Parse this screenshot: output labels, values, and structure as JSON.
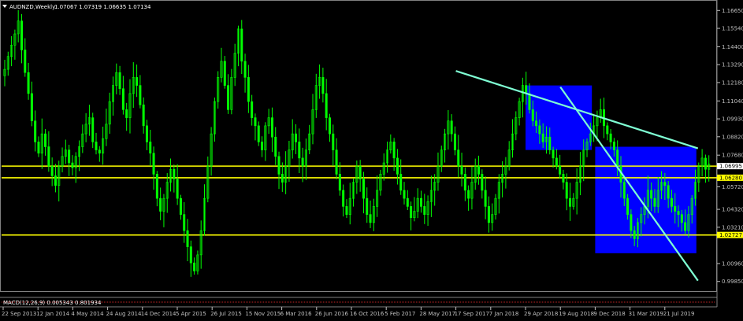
{
  "header": {
    "symbol": "AUDNZD,Weekly",
    "ohlc": "1.07067 1.07319 1.06635 1.07134"
  },
  "indicator": {
    "label": "MACD(12,26,9) 0.005343 0.801934"
  },
  "price_axis": [
    "1.16650",
    "1.15540",
    "1.14400",
    "1.13290",
    "1.12180",
    "1.11040",
    "1.09930",
    "1.08820",
    "1.07680",
    "1.05720",
    "1.04320",
    "1.03210",
    "1.00960",
    "0.99850"
  ],
  "levels": [
    {
      "label": "1.06995",
      "color": "#ffff00",
      "bg": "#ffffff",
      "price": 1.07
    },
    {
      "label": "1.06280",
      "color": "#ffff00",
      "bg": "#ffff00",
      "price": 1.0628
    },
    {
      "label": "1.02727",
      "color": "#ffff00",
      "bg": "#ffff00",
      "price": 1.0273
    }
  ],
  "dates": [
    "22 Sep 2013",
    "12 Jan 2014",
    "4 May 2014",
    "24 Aug 2014",
    "14 Dec 2014",
    "5 Apr 2015",
    "26 Jul 2015",
    "15 Nov 2015",
    "6 Mar 2016",
    "26 Jun 2016",
    "16 Oct 2016",
    "5 Feb 2017",
    "28 May 2017",
    "17 Sep 2017",
    "7 Jan 2018",
    "29 Apr 2018",
    "19 Aug 2018",
    "9 Dec 2018",
    "31 Mar 2019",
    "21 Jul 2019"
  ],
  "colors": {
    "candle": "#00ff00",
    "trendline": "#7fffd4",
    "zone": "#0000ff",
    "level": "#ffff00",
    "axis": "#c0c0c0"
  },
  "chart_data": {
    "type": "candlestick",
    "symbol": "AUDNZD",
    "timeframe": "Weekly",
    "ylim": [
      0.993,
      1.172
    ],
    "closes": [
      1.13,
      1.138,
      1.145,
      1.152,
      1.16,
      1.142,
      1.128,
      1.115,
      1.098,
      1.085,
      1.078,
      1.09,
      1.082,
      1.07,
      1.064,
      1.058,
      1.07,
      1.076,
      1.08,
      1.072,
      1.069,
      1.076,
      1.082,
      1.09,
      1.096,
      1.1,
      1.085,
      1.08,
      1.078,
      1.087,
      1.096,
      1.11,
      1.12,
      1.128,
      1.118,
      1.105,
      1.1,
      1.115,
      1.125,
      1.12,
      1.108,
      1.095,
      1.085,
      1.078,
      1.065,
      1.05,
      1.042,
      1.05,
      1.06,
      1.068,
      1.062,
      1.05,
      1.04,
      1.03,
      1.02,
      1.01,
      1.005,
      1.015,
      1.03,
      1.05,
      1.07,
      1.09,
      1.11,
      1.125,
      1.135,
      1.12,
      1.105,
      1.125,
      1.14,
      1.155,
      1.135,
      1.125,
      1.11,
      1.1,
      1.095,
      1.085,
      1.08,
      1.095,
      1.1,
      1.088,
      1.076,
      1.065,
      1.06,
      1.07,
      1.08,
      1.09,
      1.085,
      1.075,
      1.07,
      1.08,
      1.09,
      1.105,
      1.12,
      1.125,
      1.115,
      1.1,
      1.09,
      1.08,
      1.065,
      1.055,
      1.045,
      1.04,
      1.05,
      1.06,
      1.07,
      1.062,
      1.05,
      1.04,
      1.035,
      1.045,
      1.055,
      1.065,
      1.072,
      1.08,
      1.085,
      1.075,
      1.065,
      1.055,
      1.05,
      1.045,
      1.038,
      1.042,
      1.05,
      1.045,
      1.04,
      1.048,
      1.055,
      1.06,
      1.07,
      1.08,
      1.09,
      1.098,
      1.09,
      1.08,
      1.07,
      1.065,
      1.055,
      1.05,
      1.06,
      1.07,
      1.065,
      1.055,
      1.045,
      1.035,
      1.04,
      1.05,
      1.06,
      1.065,
      1.07,
      1.08,
      1.09,
      1.1,
      1.11,
      1.12,
      1.115,
      1.105,
      1.098,
      1.095,
      1.09,
      1.085,
      1.088,
      1.08,
      1.075,
      1.07,
      1.065,
      1.06,
      1.05,
      1.045,
      1.05,
      1.06,
      1.07,
      1.08,
      1.085,
      1.09,
      1.095,
      1.1,
      1.105,
      1.095,
      1.09,
      1.085,
      1.08,
      1.07,
      1.06,
      1.05,
      1.04,
      1.03,
      1.025,
      1.035,
      1.04,
      1.045,
      1.055,
      1.05,
      1.045,
      1.055,
      1.06,
      1.058,
      1.05,
      1.045,
      1.042,
      1.04,
      1.035,
      1.03,
      1.04,
      1.05,
      1.06,
      1.07,
      1.075,
      1.068,
      1.0713
    ],
    "support_levels": [
      1.06995,
      1.0628,
      1.02727
    ],
    "trendlines": [
      {
        "from": [
          "17 Sep 2017",
          1.129
        ],
        "to": [
          "21 Jul 2019",
          1.081
        ]
      },
      {
        "from": [
          "19 Aug 2018",
          1.119
        ],
        "to": [
          "21 Jul 2019",
          0.999
        ]
      }
    ],
    "zones": [
      {
        "from": "29 Apr 2018",
        "to": "19 Aug 2018",
        "top": 1.12,
        "bottom": 1.08
      },
      {
        "from": "9 Dec 2018",
        "to": "21 Jul 2019",
        "top": 1.082,
        "bottom": 1.016
      }
    ]
  }
}
